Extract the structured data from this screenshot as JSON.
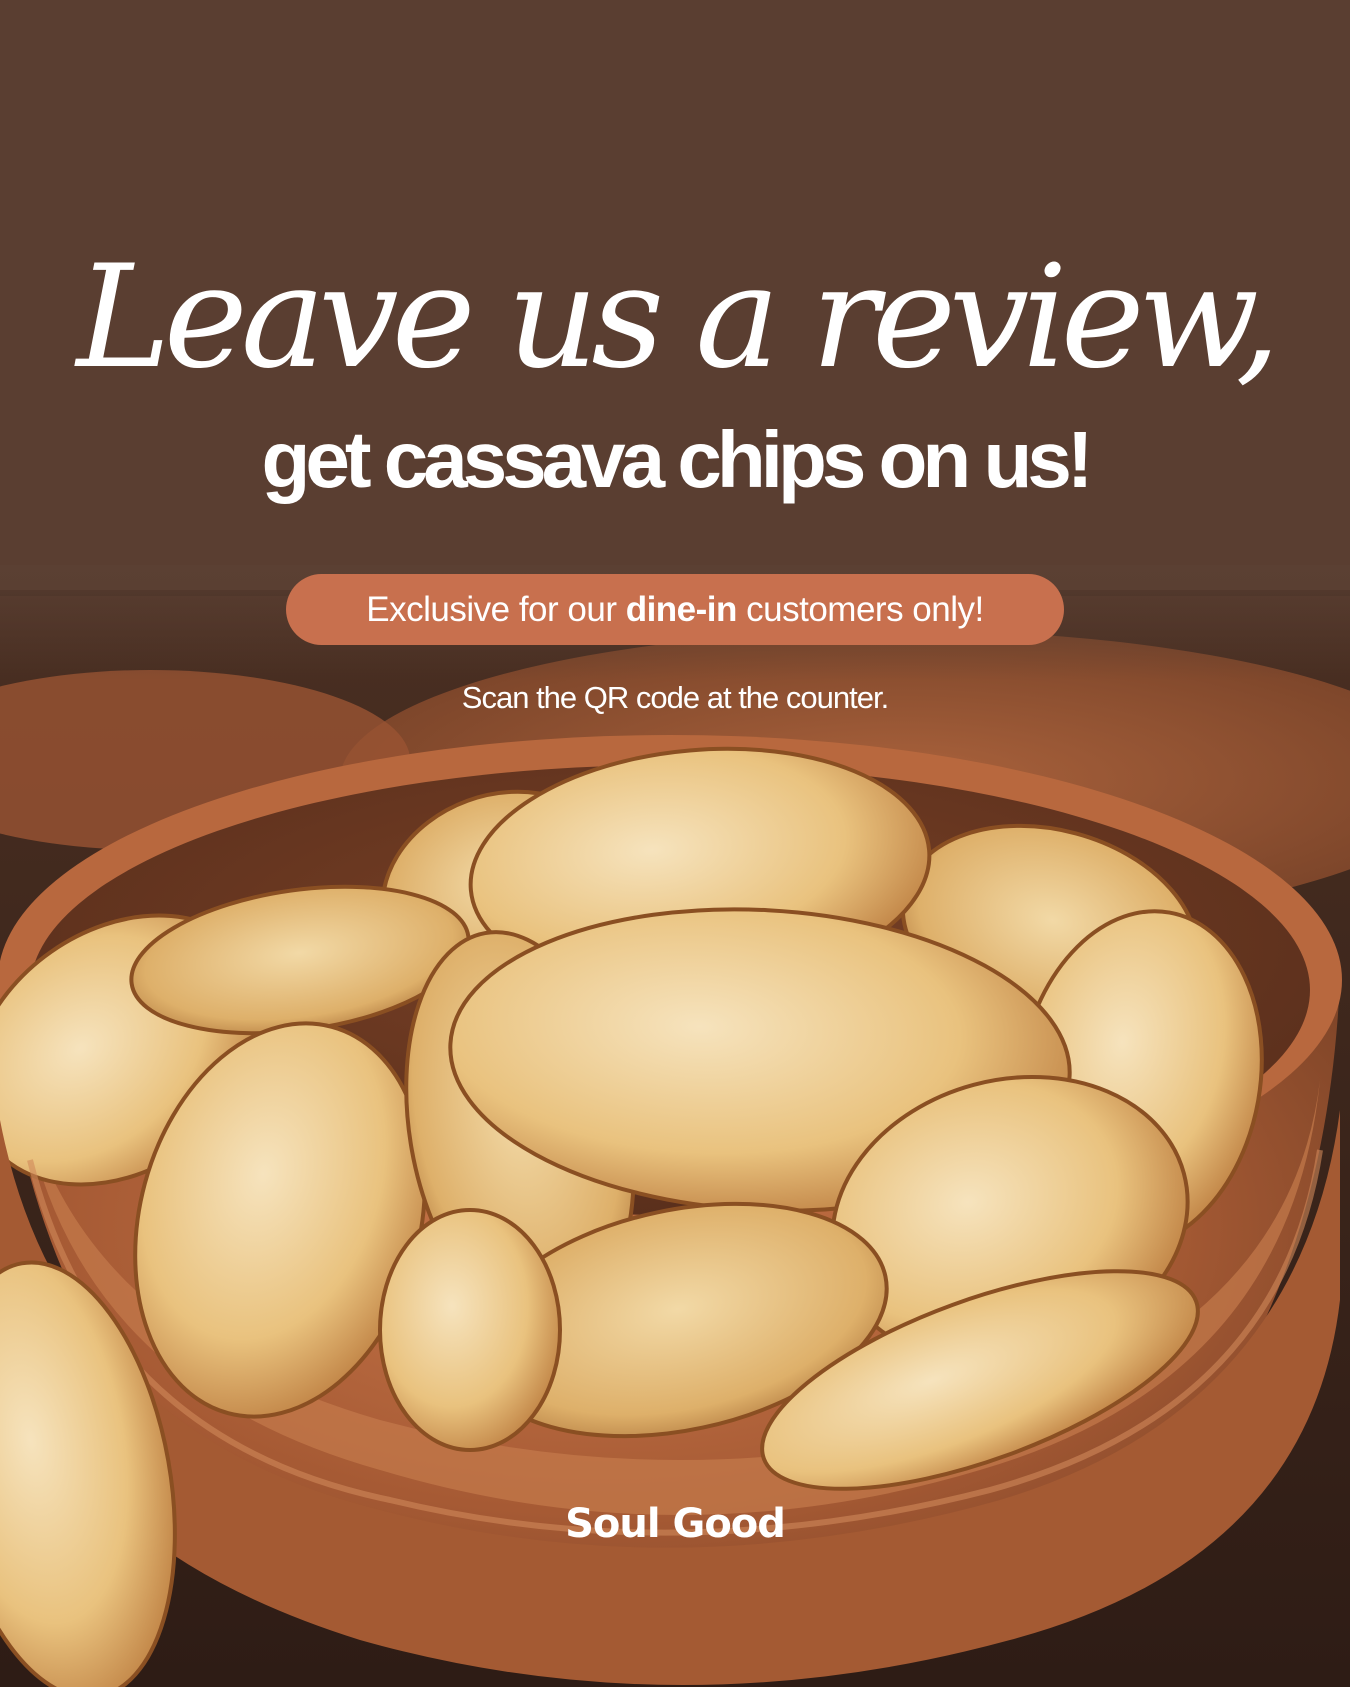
{
  "headline": {
    "script_line": "Leave us a review,",
    "bold_line": "get cassava chips on us!"
  },
  "badge": {
    "text_before": "Exclusive for our ",
    "text_emphasis": "dine-in",
    "text_after": " customers only!"
  },
  "instruction": "Scan the QR code at the counter.",
  "brand": {
    "logo_text": "Soul Good"
  },
  "colors": {
    "background_brown": "#5a3e31",
    "badge_terracotta": "#c8704e",
    "bowl_wood": "#b8683e",
    "chip_gold": "#e8b670",
    "text": "#ffffff"
  },
  "icons": {
    "logo": "soul-good-wordmark"
  }
}
